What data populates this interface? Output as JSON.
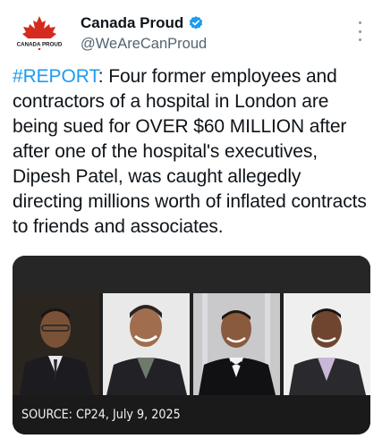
{
  "author": {
    "display_name": "Canada Proud",
    "handle": "@WeAreCanProud",
    "verified": true,
    "avatar_text": "CANADA PROUD",
    "avatar_icon": "maple-leaf-icon",
    "brand_red": "#d52b1e"
  },
  "tweet": {
    "hashtag": "#REPORT",
    "text": ": Four former employees and contractors of a hospital in London are being sued for OVER $60 MILLION after after one of the hospital's executives, Dipesh Patel, was caught allegedly directing millions worth of inflated contracts to friends and associates."
  },
  "media": {
    "caption": "SOURCE: CP24, July 9, 2025",
    "photo_count": 4
  },
  "colors": {
    "link": "#1d9bf0",
    "verified": "#1d9bf0",
    "secondary_text": "#536471"
  }
}
